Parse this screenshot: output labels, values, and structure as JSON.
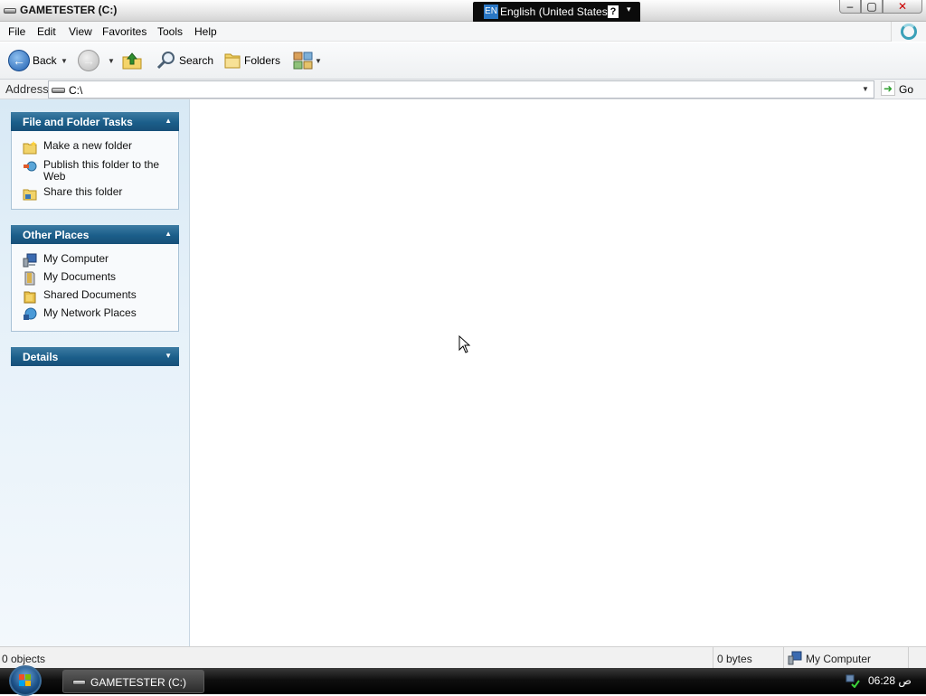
{
  "window": {
    "title": "GAMETESTER (C:)",
    "controls": {
      "minimize": "–",
      "maximize": "▢",
      "close": "✕"
    }
  },
  "language_bar": {
    "code": "EN",
    "language": "English (United States)",
    "help": "?",
    "arrow": "▾"
  },
  "menu": {
    "items": [
      "File",
      "Edit",
      "View",
      "Favorites",
      "Tools",
      "Help"
    ]
  },
  "toolbar": {
    "back_label": "Back",
    "search_label": "Search",
    "folders_label": "Folders"
  },
  "address": {
    "label": "Address",
    "value": "C:\\",
    "go_label": "Go"
  },
  "left_pane": {
    "file_folder_tasks": {
      "title": "File and Folder Tasks",
      "items": [
        "Make a new folder",
        "Publish this folder to the Web",
        "Share this folder"
      ]
    },
    "other_places": {
      "title": "Other Places",
      "items": [
        "My Computer",
        "My Documents",
        "Shared Documents",
        "My Network Places"
      ]
    },
    "details": {
      "title": "Details"
    }
  },
  "status_bar": {
    "objects": "0 objects",
    "size": "0 bytes",
    "location": "My Computer"
  },
  "taskbar": {
    "window_button": "GAMETESTER (C:)",
    "clock": "06:28 ص"
  },
  "colors": {
    "panel_header": "#1b5e8a",
    "left_pane_bg": "#d8e9f5",
    "taskbar": "#0f0f0f"
  }
}
